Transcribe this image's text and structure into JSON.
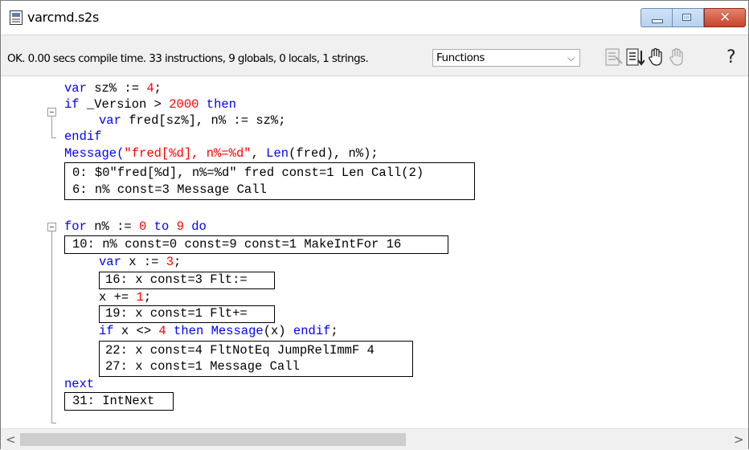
{
  "window": {
    "title": "varcmd.s2s"
  },
  "status": {
    "text": "OK. 0.00 secs compile time. 33 instructions, 9 globals, 0 locals, 1 strings.",
    "functions_select": "Functions"
  },
  "toolbar": {
    "icons": [
      "toggle-compiled-icon",
      "step-down-icon",
      "hand-icon",
      "hand-disabled-icon",
      "help-icon"
    ],
    "help_label": "?"
  },
  "code": {
    "l1": [
      "var",
      " sz% := ",
      "4",
      ";"
    ],
    "l2": [
      "if",
      " _Version > ",
      "2000",
      " ",
      "then"
    ],
    "l3": [
      "var",
      " fred[sz%], n% := sz%;"
    ],
    "l4": "endif",
    "l5": [
      "Message(",
      "\"fred[%d], n%=%d\"",
      ", ",
      "Len",
      "(fred), n%);"
    ],
    "b1": [
      "0: $0\"fred[%d], n%=%d\" fred const=1 Len Call(2)",
      "6: n% const=3 Message Call"
    ],
    "l6": [
      "for",
      " n% := ",
      "0",
      " ",
      "to",
      " ",
      "9",
      " ",
      "do"
    ],
    "b2": "10: n% const=0 const=9 const=1 MakeIntFor 16",
    "l7": [
      "var",
      " x := ",
      "3",
      ";"
    ],
    "b3": "16: x const=3 Flt:=",
    "l8": [
      "x += ",
      "1",
      ";"
    ],
    "b4": "19: x const=1 Flt+=",
    "l9": [
      "if",
      " x <> ",
      "4",
      " ",
      "then",
      " ",
      "Message",
      "(x) ",
      "endif",
      ";"
    ],
    "b5": [
      "22: x const=4 FltNotEq JumpRelImmF 4",
      "27: x const=1 Message Call"
    ],
    "l10": "next",
    "b6": "31: IntNext"
  },
  "colors": {
    "keyword": "#0000ff",
    "literal": "#ff0000",
    "text": "#000000",
    "close_button": "#c8432b"
  }
}
